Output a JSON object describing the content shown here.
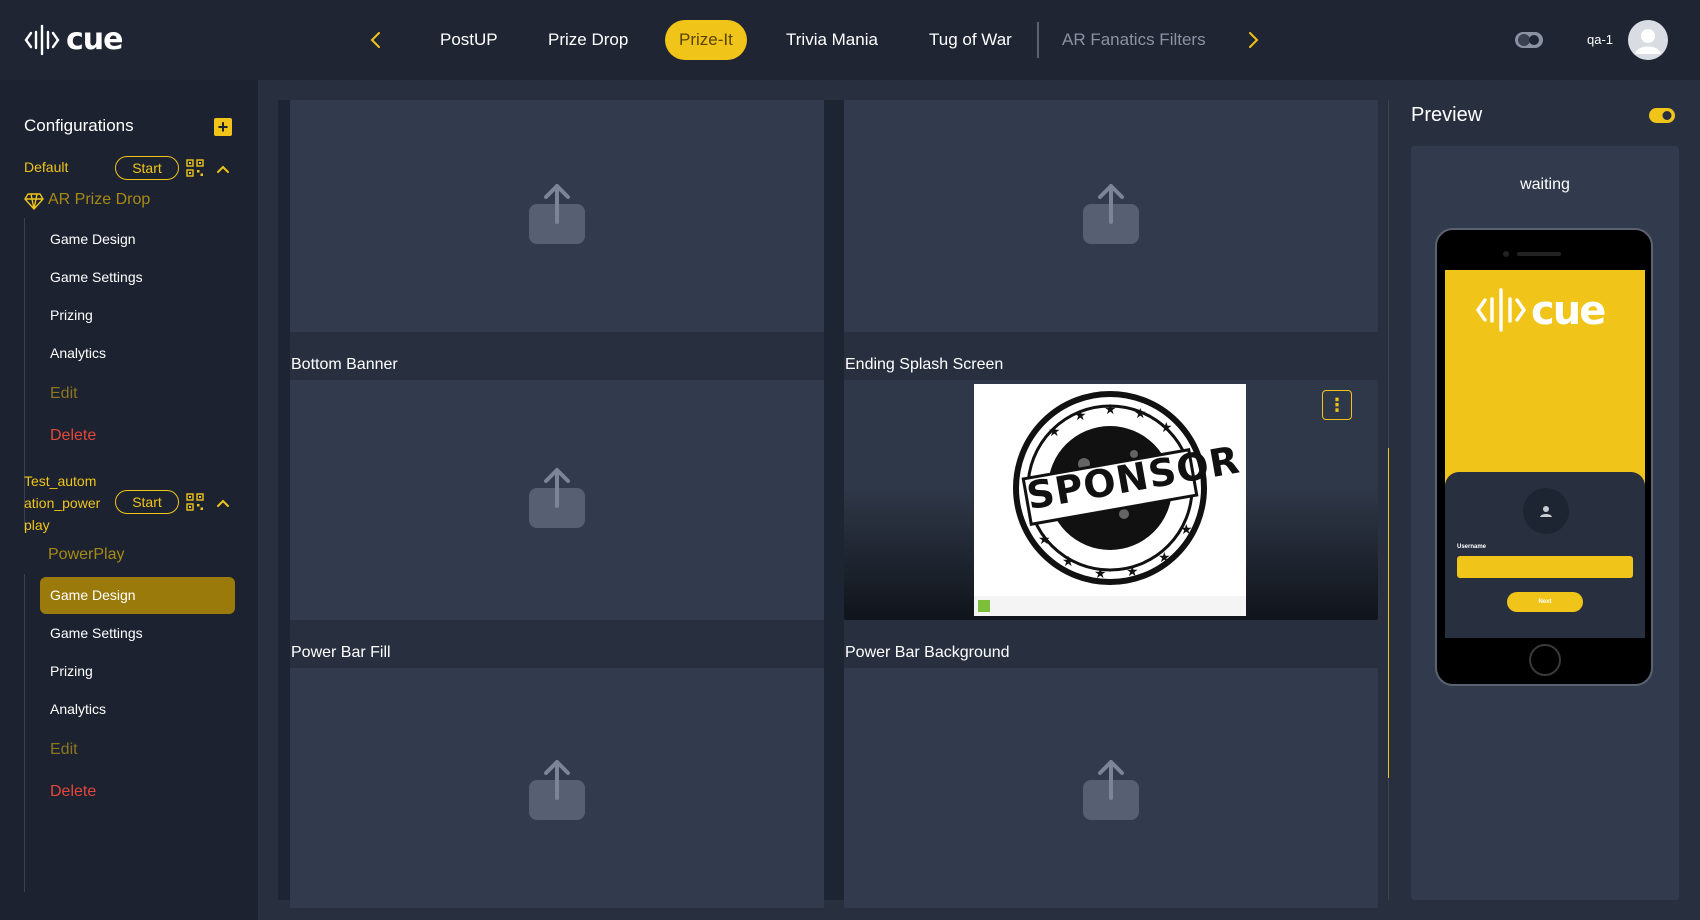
{
  "app": {
    "logo_text": "cue",
    "user_name": "qa-1"
  },
  "tabs": [
    {
      "label": "PostUP"
    },
    {
      "label": "Prize Drop"
    },
    {
      "label": "Prize-It"
    },
    {
      "label": "Trivia Mania"
    },
    {
      "label": "Tug of War"
    },
    {
      "label": "AR Fanatics Filters"
    }
  ],
  "active_tab": "Prize-It",
  "sidebar": {
    "title": "Configurations",
    "add_icon": "+",
    "configs": [
      {
        "name": "Default",
        "start_label": "Start",
        "game_type": "AR Prize Drop",
        "items": [
          "Game Design",
          "Game Settings",
          "Prizing",
          "Analytics",
          "Edit",
          "Delete"
        ]
      },
      {
        "name_lines": [
          "Test_autom",
          "ation_power",
          "play"
        ],
        "start_label": "Start",
        "game_type": "PowerPlay",
        "items": [
          "Game Design",
          "Game Settings",
          "Prizing",
          "Analytics",
          "Edit",
          "Delete"
        ],
        "active_item": "Game Design"
      }
    ]
  },
  "main": {
    "cards": [
      {
        "label": ""
      },
      {
        "label": ""
      },
      {
        "label": "Bottom Banner"
      },
      {
        "label": "Ending Splash Screen",
        "image_text": "SPONSOR"
      },
      {
        "label": "Power Bar Fill"
      },
      {
        "label": "Power Bar Background"
      }
    ],
    "kebab_icon": "⋮"
  },
  "preview": {
    "title": "Preview",
    "status": "waiting",
    "toggle_on": true,
    "phone": {
      "logo_text": "cue",
      "username_label": "Username",
      "next_label": "Next"
    }
  },
  "colors": {
    "accent": "#f0c419",
    "background": "#1c2230",
    "panel": "#283040",
    "card": "#323b4d",
    "danger": "#e2473a"
  },
  "icons": {
    "nav_prev": "chevron-left-icon",
    "nav_next": "chevron-right-icon",
    "upload": "upload-icon",
    "qr": "qr-code-icon",
    "collapse": "chevron-up-icon"
  }
}
